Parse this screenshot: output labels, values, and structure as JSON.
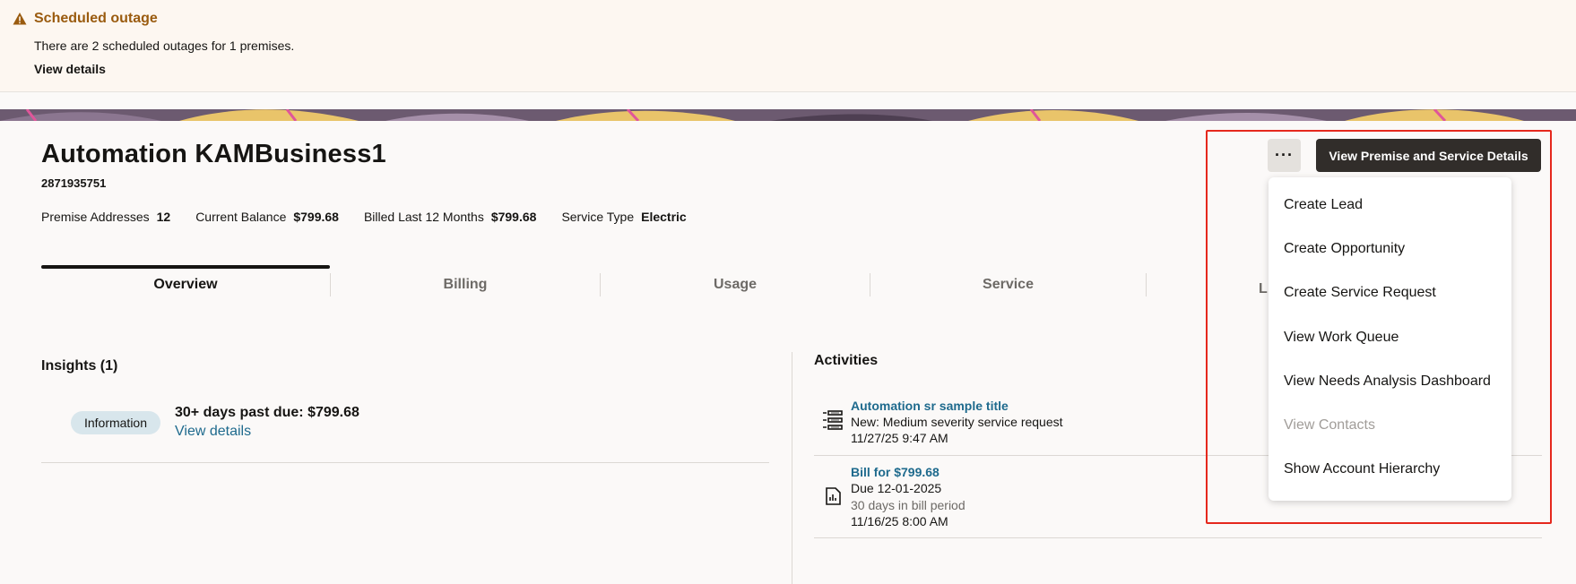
{
  "banner": {
    "title": "Scheduled outage",
    "message": "There are 2 scheduled outages for 1 premises.",
    "link": "View details"
  },
  "account": {
    "name": "Automation KAMBusiness1",
    "number": "2871935751",
    "facts": [
      {
        "label": "Premise Addresses",
        "value": "12"
      },
      {
        "label": "Current Balance",
        "value": "$799.68"
      },
      {
        "label": "Billed Last 12 Months",
        "value": "$799.68"
      },
      {
        "label": "Service Type",
        "value": "Electric"
      }
    ]
  },
  "tabs": [
    {
      "label": "Overview",
      "active": true
    },
    {
      "label": "Billing"
    },
    {
      "label": "Usage"
    },
    {
      "label": "Service"
    },
    {
      "label": "L"
    }
  ],
  "insights": {
    "title": "Insights (1)",
    "badge": "Information",
    "headline": "30+ days past due: $799.68",
    "link": "View details"
  },
  "activities": {
    "title": "Activities",
    "items": [
      {
        "icon": "service-request-icon",
        "title": "Automation sr sample title",
        "lines": [
          "New: Medium severity service request",
          "11/27/25 9:47 AM"
        ]
      },
      {
        "icon": "bill-icon",
        "title": "Bill for $799.68",
        "lines": [
          "Due 12-01-2025",
          "30 days in bill period",
          "11/16/25 8:00 AM"
        ]
      }
    ]
  },
  "actions": {
    "more_label": "···",
    "primary_label": "View Premise and Service Details"
  },
  "menu": {
    "items": [
      {
        "label": "Create Lead"
      },
      {
        "label": "Create Opportunity"
      },
      {
        "label": "Create Service Request"
      },
      {
        "label": "View Work Queue"
      },
      {
        "label": "View Needs Analysis Dashboard"
      },
      {
        "label": "View Contacts",
        "disabled": true
      },
      {
        "label": "Show Account Hierarchy"
      }
    ]
  },
  "colors": {
    "warning": "#9a5b0f",
    "link": "#1e6a8d",
    "primary_button": "#312d2a",
    "highlight_frame": "#e5281d"
  }
}
